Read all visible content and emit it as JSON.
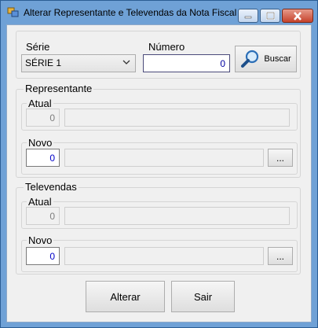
{
  "window": {
    "title": "Alterar Representante e Televendas da Nota Fiscal"
  },
  "header": {
    "serie_label": "Série",
    "serie_value": "SÉRIE 1",
    "numero_label": "Número",
    "numero_value": "0",
    "buscar_label": "Buscar"
  },
  "representante": {
    "group_label": "Representante",
    "atual": {
      "label": "Atual",
      "code": "0",
      "name": ""
    },
    "novo": {
      "label": "Novo",
      "code": "0",
      "name": "",
      "browse_label": "..."
    }
  },
  "televendas": {
    "group_label": "Televendas",
    "atual": {
      "label": "Atual",
      "code": "0",
      "name": ""
    },
    "novo": {
      "label": "Novo",
      "code": "0",
      "name": "",
      "browse_label": "..."
    }
  },
  "actions": {
    "alterar_label": "Alterar",
    "sair_label": "Sair"
  }
}
